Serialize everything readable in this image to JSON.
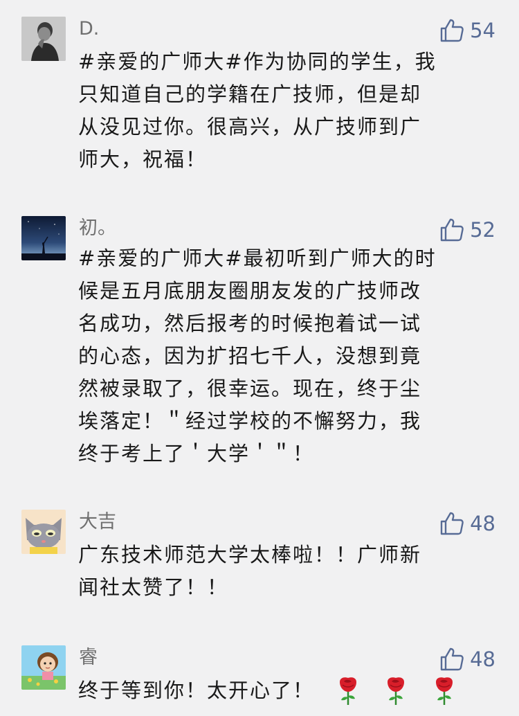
{
  "comments": [
    {
      "name": "D.",
      "likes": "54",
      "avatar": "man-portrait-avatar",
      "lines": [
        "#亲爱的广师大#作为协同的学生，我",
        "只知道自己的学籍在广技师，但是却",
        "从没见过你。很高兴，从广技师到广",
        "师大，祝福！"
      ]
    },
    {
      "name": "初。",
      "likes": "52",
      "avatar": "night-sky-avatar",
      "lines": [
        "#亲爱的广师大#最初听到广师大的时",
        "候是五月底朋友圈朋友发的广技师改",
        "名成功，然后报考的时候抱着试一试",
        "的心态，因为扩招七千人，没想到竟",
        "然被录取了，很幸运。现在，终于尘",
        "埃落定！＂经过学校的不懈努力，我",
        "终于考上了＇大学＇＂！"
      ]
    },
    {
      "name": "大吉",
      "likes": "48",
      "avatar": "cartoon-cat-avatar",
      "lines": [
        "广东技术师范大学太棒啦！！广师新",
        "闻社太赞了！！"
      ]
    },
    {
      "name": "睿",
      "likes": "48",
      "avatar": "cartoon-girl-avatar",
      "lines": [
        "终于等到你！太开心了！"
      ],
      "emoji": [
        "rose-emoji",
        "rose-emoji",
        "rose-emoji"
      ]
    }
  ],
  "colors": {
    "background": "#f1f1f2",
    "like": "#576b95",
    "name": "#6f6f6f",
    "text": "#191919"
  },
  "icons": {
    "like": "thumbs-up-icon"
  }
}
